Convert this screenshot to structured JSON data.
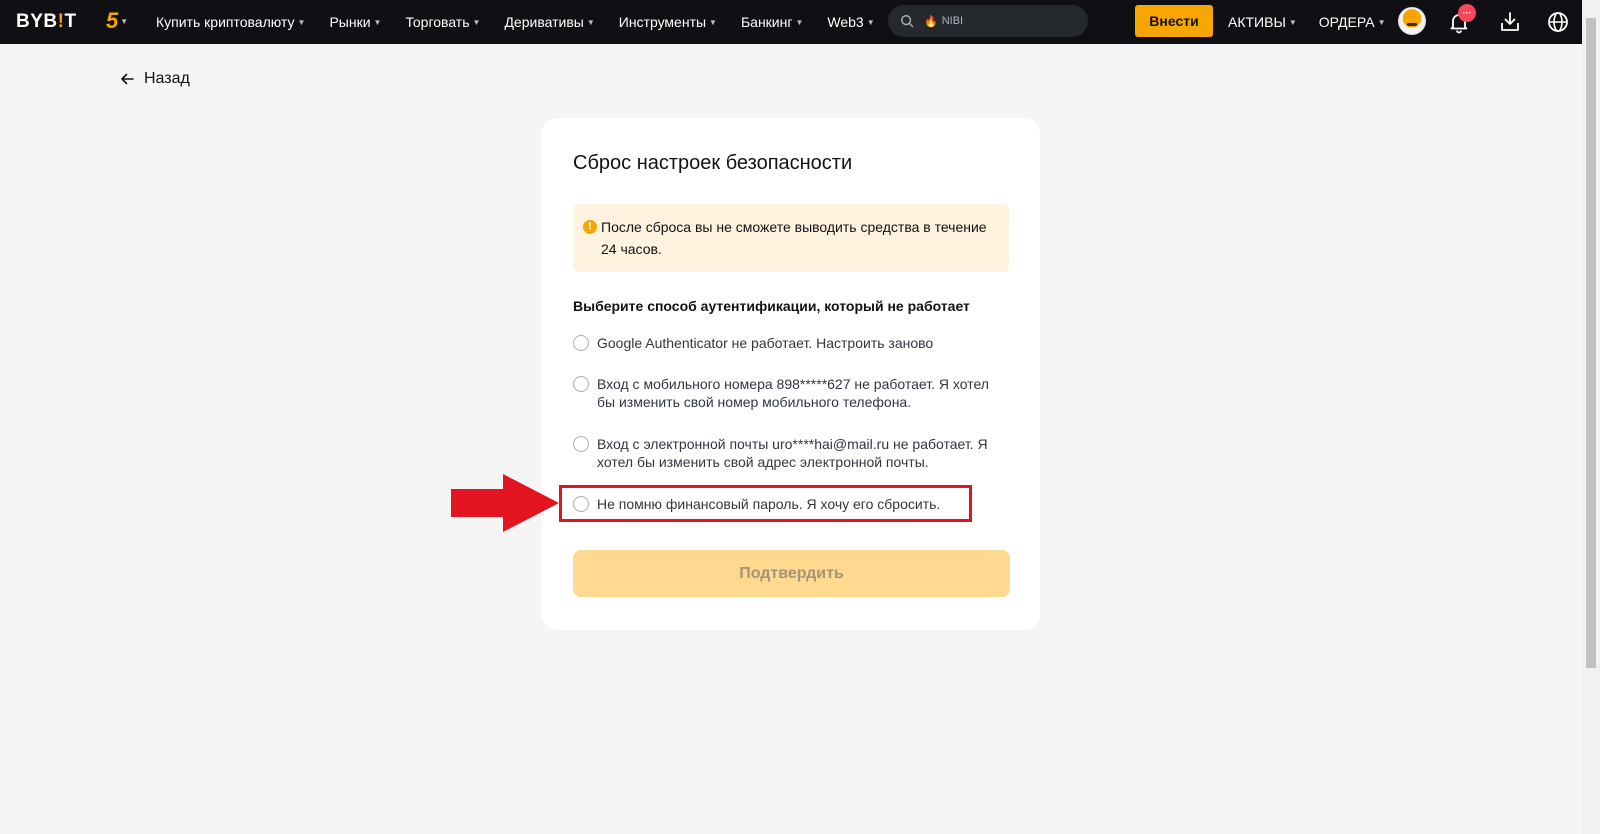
{
  "header": {
    "logo_prefix": "BYB",
    "logo_mark": "!",
    "logo_suffix": "T",
    "anniversary_badge": "5",
    "nav": [
      "Купить криптовалюту",
      "Рынки",
      "Торговать",
      "Деривативы",
      "Инструменты",
      "Банкинг",
      "Web3"
    ],
    "search": {
      "placeholder": "NIBI"
    },
    "deposit_label": "Внести",
    "assets_label": "АКТИВЫ",
    "orders_label": "ОРДЕРА",
    "notification_badge": "···"
  },
  "back_label": "Назад",
  "card": {
    "title": "Сброс настроек безопасности",
    "warning": "После сброса вы не сможете выводить средства в течение 24 часов.",
    "question": "Выберите способ аутентификации, который не работает",
    "options": [
      "Google Authenticator не работает. Настроить заново",
      "Вход с мобильного номера 898*****627 не работает. Я хотел бы изменить свой номер мобильного телефона.",
      "Вход с электронной почты uro****hai@mail.ru не работает. Я хотел бы изменить свой адрес электронной почты.",
      "Не помню финансовый пароль. Я хочу его сбросить."
    ],
    "confirm_label": "Подтвердить"
  },
  "colors": {
    "topbar": "#101014",
    "accent": "#f7a600",
    "warning_bg": "#fff3e0",
    "confirm_disabled": "#ffd98f",
    "annotation_red": "#e3141f"
  },
  "icons": {
    "back": "arrow-left-icon",
    "search": "search-icon",
    "trending": "fire-icon",
    "warning": "exclamation-circle-icon",
    "notifications": "bell-icon",
    "download": "download-icon",
    "language": "globe-icon"
  }
}
